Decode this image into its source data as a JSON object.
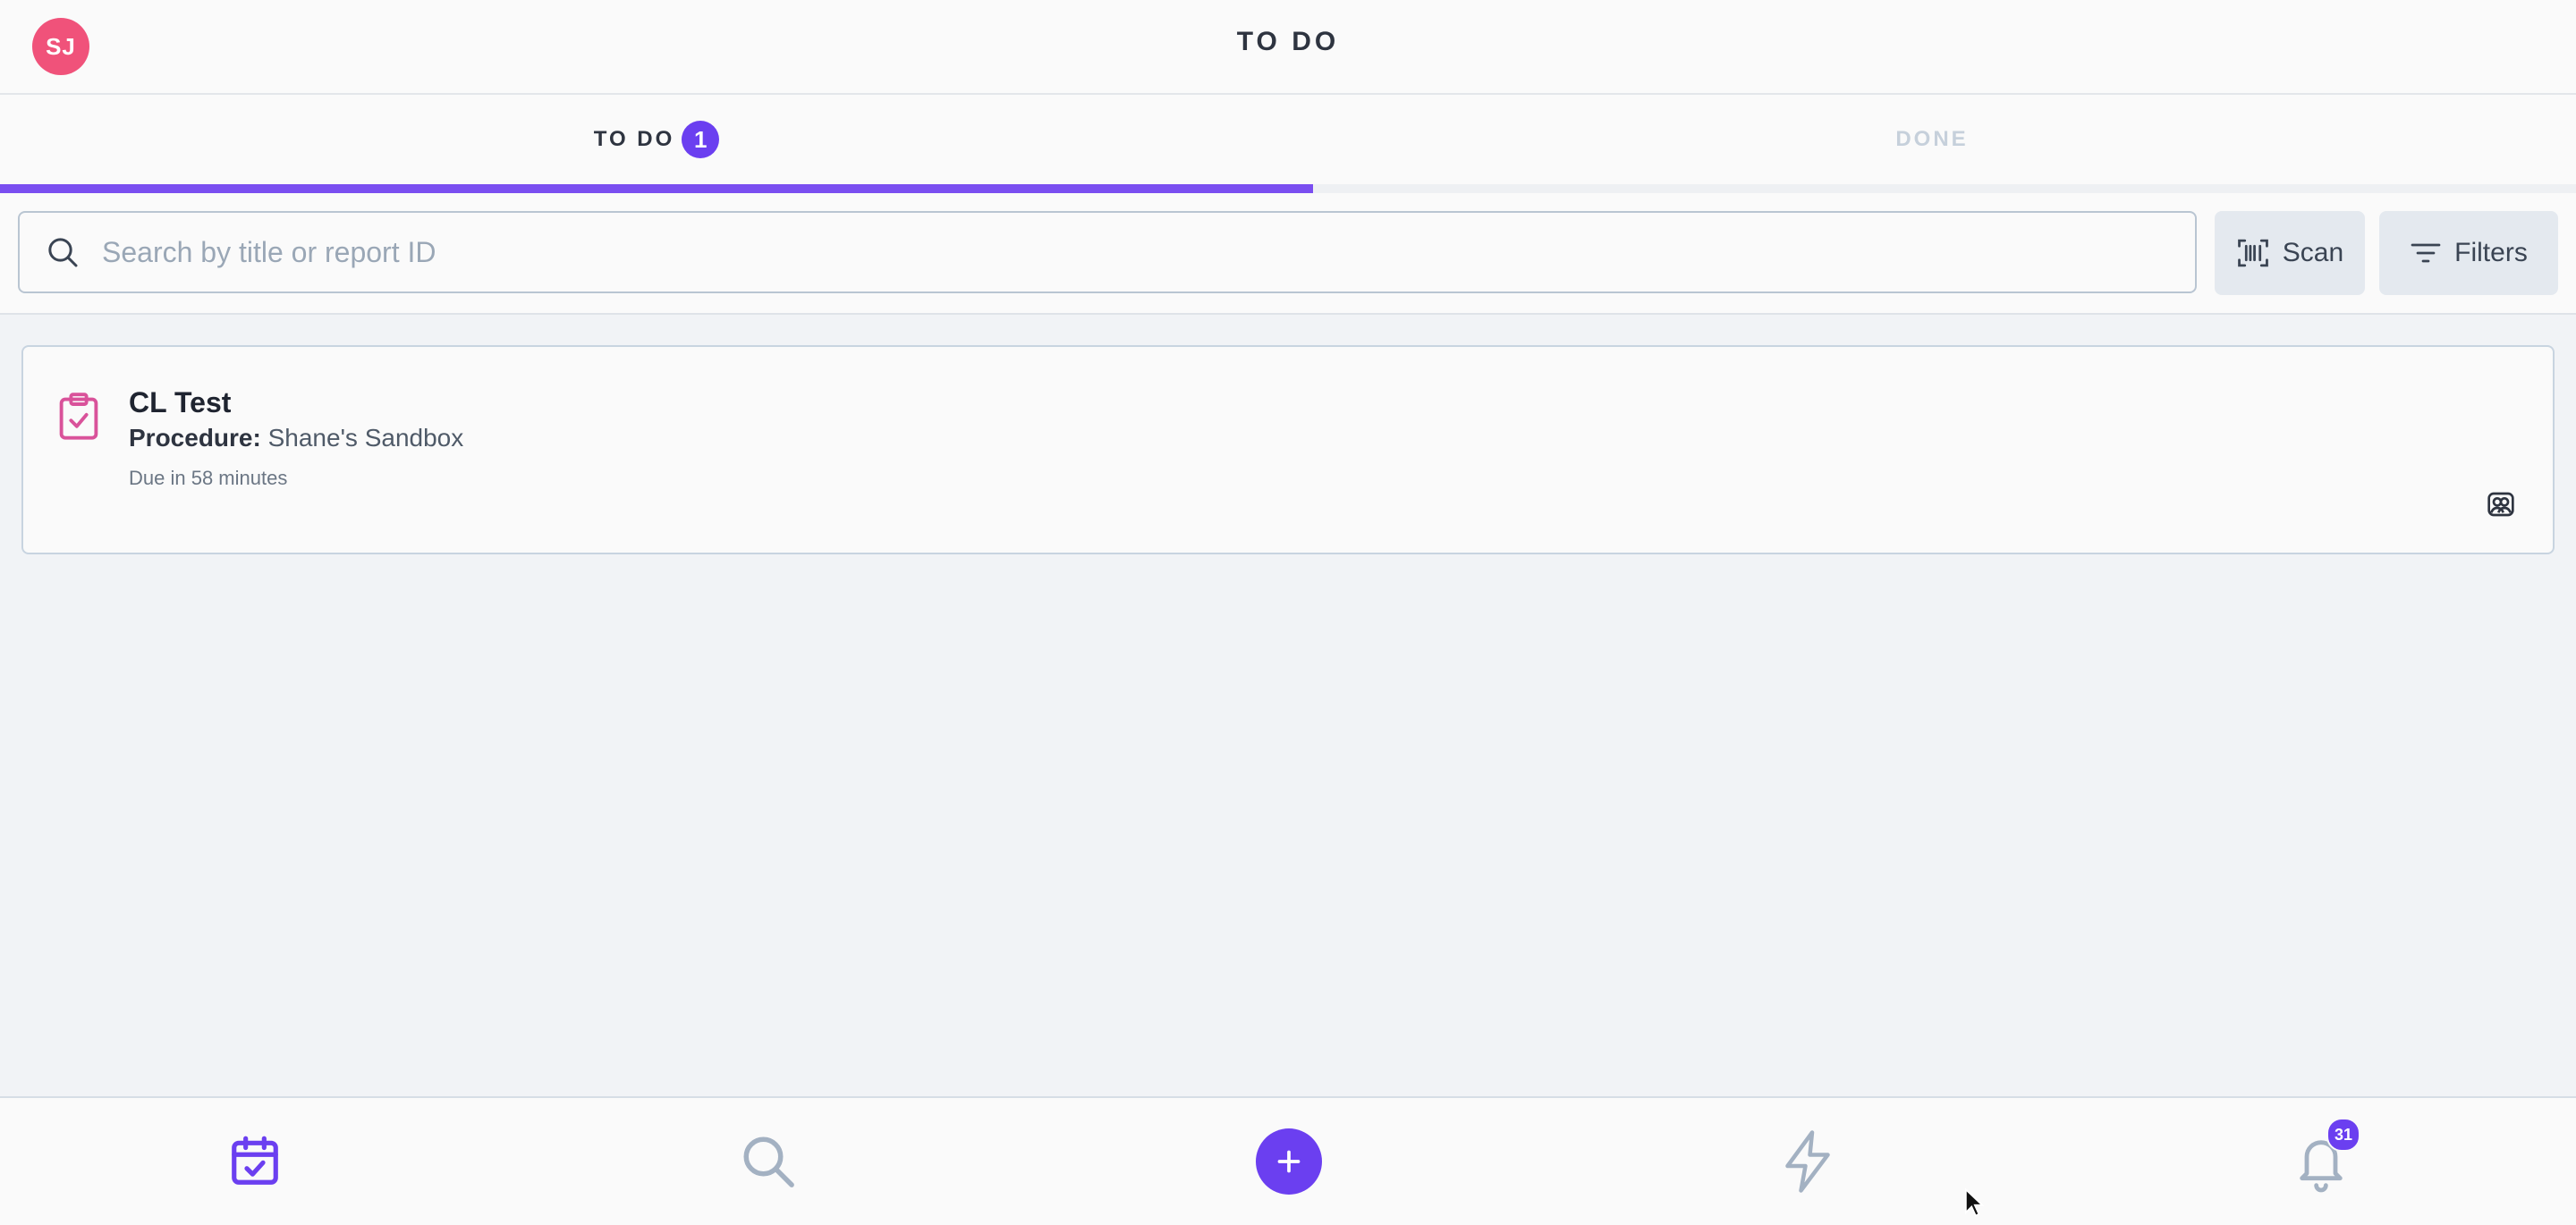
{
  "header": {
    "avatar_initials": "SJ",
    "title": "TO DO"
  },
  "tabs": [
    {
      "label": "TO DO",
      "badge": "1",
      "active": true
    },
    {
      "label": "DONE",
      "active": false
    }
  ],
  "search": {
    "placeholder": "Search by title or report ID",
    "value": ""
  },
  "toolbar": {
    "scan_label": "Scan",
    "filters_label": "Filters"
  },
  "tasks": [
    {
      "title": "CL Test",
      "procedure_label": "Procedure:",
      "procedure_value": "Shane's Sandbox",
      "due": "Due in 58 minutes",
      "icon": "clipboard-check-icon",
      "assignee_icon": "team-icon"
    }
  ],
  "bottom_nav": {
    "items": [
      "calendar-check-icon",
      "search-icon",
      "plus-icon",
      "bolt-icon",
      "bell-icon"
    ],
    "notifications_count": "31"
  },
  "colors": {
    "accent": "#6b3ff0",
    "avatar": "#f0527a",
    "task_icon": "#d9529a"
  }
}
